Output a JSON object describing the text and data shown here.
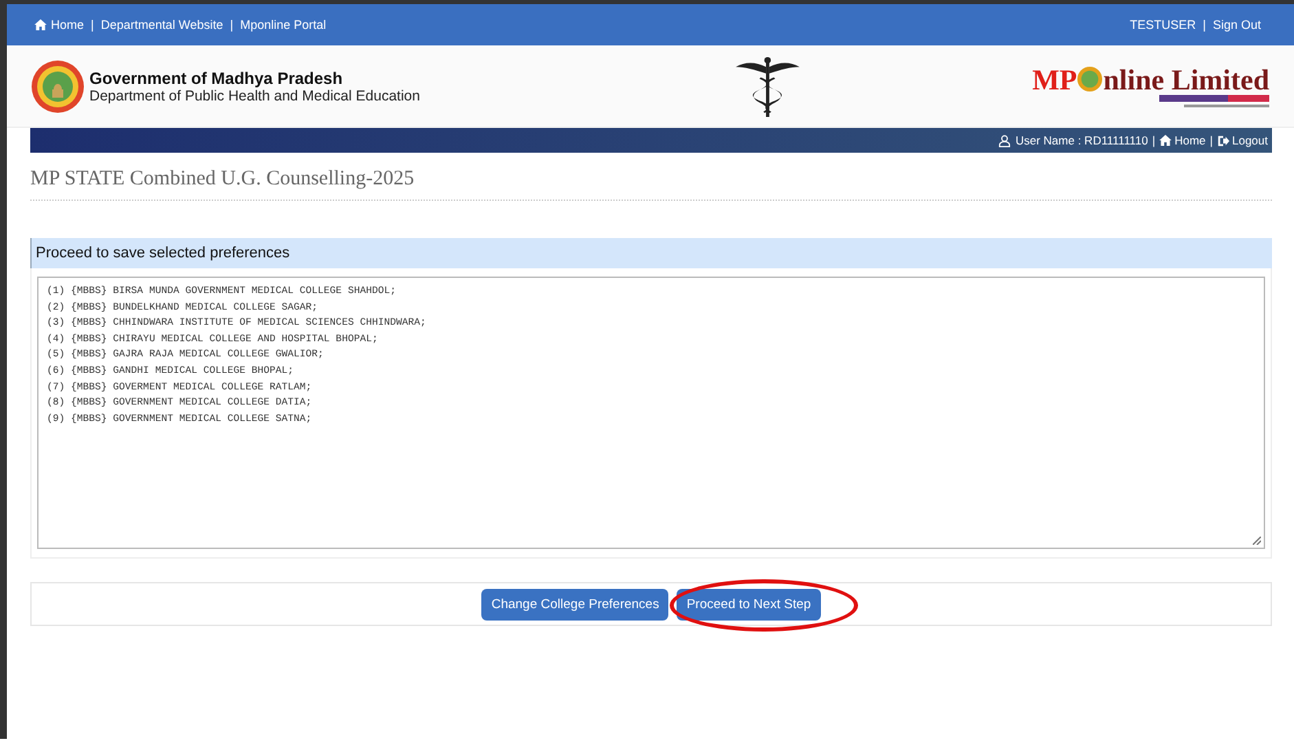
{
  "top_bar": {
    "links": [
      {
        "kind": "link",
        "label": "Home"
      },
      {
        "kind": "separator",
        "label": "|"
      },
      {
        "kind": "link",
        "label": "Departmental Website"
      },
      {
        "kind": "separator",
        "label": "|"
      },
      {
        "kind": "link",
        "label": "Mponline Portal"
      }
    ],
    "user": "TESTUSER",
    "user_separator": "|",
    "sign_out": "Sign Out"
  },
  "header": {
    "title": "Government of Madhya Pradesh",
    "subtitle": "Department of Public Health and Medical Education",
    "logo_left": "MP",
    "logo_right": "nline Limited"
  },
  "user_bar": {
    "user_label": "User Name : RD11111110",
    "separators": [
      "|",
      "|"
    ],
    "home": "Home",
    "logout": "Logout"
  },
  "page_title": "MP STATE Combined U.G. Counselling-2025",
  "panel": {
    "heading": "Proceed to save selected preferences",
    "preferences": [
      "(1) {MBBS} BIRSA MUNDA GOVERNMENT MEDICAL COLLEGE SHAHDOL;",
      "(2) {MBBS} BUNDELKHAND MEDICAL COLLEGE SAGAR;",
      "(3) {MBBS} CHHINDWARA INSTITUTE OF MEDICAL SCIENCES CHHINDWARA;",
      "(4) {MBBS} CHIRAYU MEDICAL COLLEGE AND HOSPITAL BHOPAL;",
      "(5) {MBBS} GAJRA RAJA MEDICAL COLLEGE GWALIOR;",
      "(6) {MBBS} GANDHI MEDICAL COLLEGE BHOPAL;",
      "(7) {MBBS} GOVERMENT MEDICAL COLLEGE RATLAM;",
      "(8) {MBBS} GOVERNMENT MEDICAL COLLEGE DATIA;",
      "(9) {MBBS} GOVERNMENT MEDICAL COLLEGE SATNA;"
    ]
  },
  "buttons": [
    {
      "label": "Change College Preferences",
      "highlighted": false
    },
    {
      "label": "Proceed to Next Step",
      "highlighted": true
    }
  ]
}
